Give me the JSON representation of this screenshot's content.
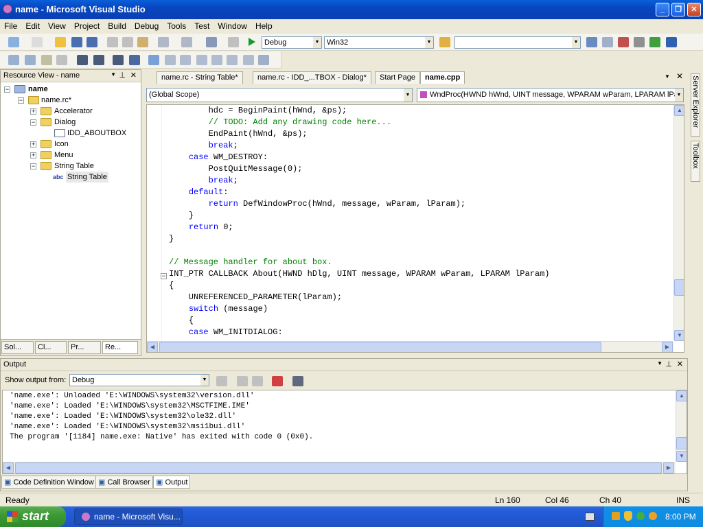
{
  "window": {
    "title": "name - Microsoft Visual Studio"
  },
  "menu": [
    "File",
    "Edit",
    "View",
    "Project",
    "Build",
    "Debug",
    "Tools",
    "Test",
    "Window",
    "Help"
  ],
  "toolbar": {
    "config": "Debug",
    "platform": "Win32",
    "find": ""
  },
  "resource_view": {
    "title": "Resource View - name",
    "root": "name",
    "rc": "name.rc*",
    "items": [
      {
        "label": "Accelerator",
        "expanded": false
      },
      {
        "label": "Dialog",
        "expanded": true
      },
      {
        "label": "IDD_ABOUTBOX",
        "child": true
      },
      {
        "label": "Icon",
        "expanded": false
      },
      {
        "label": "Menu",
        "expanded": false
      },
      {
        "label": "String Table",
        "expanded": true
      },
      {
        "label": "String Table",
        "child": true
      }
    ],
    "bottom_tabs": [
      "Sol...",
      "Cl...",
      "Pr...",
      "Re..."
    ]
  },
  "editor": {
    "tabs": [
      "name.rc - String Table*",
      "name.rc - IDD_...TBOX - Dialog*",
      "Start Page",
      "name.cpp"
    ],
    "scope": "(Global Scope)",
    "member": "WndProc(HWND hWnd, UINT message, WPARAM wParam, LPARAM lPara",
    "lines": [
      [
        {
          "t": "        hdc = BeginPaint(hWnd, &ps);"
        }
      ],
      [
        {
          "t": "        "
        },
        {
          "t": "// TODO: Add any drawing code here...",
          "c": "cm"
        }
      ],
      [
        {
          "t": "        EndPaint(hWnd, &ps);"
        }
      ],
      [
        {
          "t": "        "
        },
        {
          "t": "break",
          "c": "kw"
        },
        {
          "t": ";"
        }
      ],
      [
        {
          "t": "    "
        },
        {
          "t": "case",
          "c": "kw"
        },
        {
          "t": " WM_DESTROY:"
        }
      ],
      [
        {
          "t": "        PostQuitMessage(0);"
        }
      ],
      [
        {
          "t": "        "
        },
        {
          "t": "break",
          "c": "kw"
        },
        {
          "t": ";"
        }
      ],
      [
        {
          "t": "    "
        },
        {
          "t": "default",
          "c": "kw"
        },
        {
          "t": ":"
        }
      ],
      [
        {
          "t": "        "
        },
        {
          "t": "return",
          "c": "kw"
        },
        {
          "t": " DefWindowProc(hWnd, message, wParam, lParam);"
        }
      ],
      [
        {
          "t": "    }"
        }
      ],
      [
        {
          "t": "    "
        },
        {
          "t": "return",
          "c": "kw"
        },
        {
          "t": " 0;"
        }
      ],
      [
        {
          "t": "}"
        }
      ],
      [
        {
          "t": ""
        }
      ],
      [
        {
          "t": "// Message handler for about box.",
          "c": "cm"
        }
      ],
      [
        {
          "t": "INT_PTR CALLBACK About(HWND hDlg, UINT message, WPARAM wParam, LPARAM lParam)"
        }
      ],
      [
        {
          "t": "{"
        }
      ],
      [
        {
          "t": "    UNREFERENCED_PARAMETER(lParam);"
        }
      ],
      [
        {
          "t": "    "
        },
        {
          "t": "switch",
          "c": "kw"
        },
        {
          "t": " (message)"
        }
      ],
      [
        {
          "t": "    {"
        }
      ],
      [
        {
          "t": "    "
        },
        {
          "t": "case",
          "c": "kw"
        },
        {
          "t": " WM_INITDIALOG:"
        }
      ]
    ]
  },
  "output": {
    "title": "Output",
    "show_label": "Show output from:",
    "source": "Debug",
    "lines": [
      "'name.exe': Unloaded 'E:\\WINDOWS\\system32\\version.dll'",
      "'name.exe': Loaded 'E:\\WINDOWS\\system32\\MSCTFIME.IME'",
      "'name.exe': Loaded 'E:\\WINDOWS\\system32\\ole32.dll'",
      "'name.exe': Loaded 'E:\\WINDOWS\\system32\\msi1bui.dll'",
      "The program '[1184] name.exe: Native' has exited with code 0 (0x0)."
    ],
    "bottom_tabs": [
      "Code Definition Window",
      "Call Browser",
      "Output"
    ]
  },
  "side": {
    "server_explorer": "Server Explorer",
    "toolbox": "Toolbox"
  },
  "status": {
    "text": "Ready",
    "ln": "Ln 160",
    "col": "Col 46",
    "ch": "Ch 40",
    "mode": "INS"
  },
  "taskbar": {
    "start": "start",
    "task": "name - Microsoft Visu...",
    "time": "8:00 PM"
  }
}
